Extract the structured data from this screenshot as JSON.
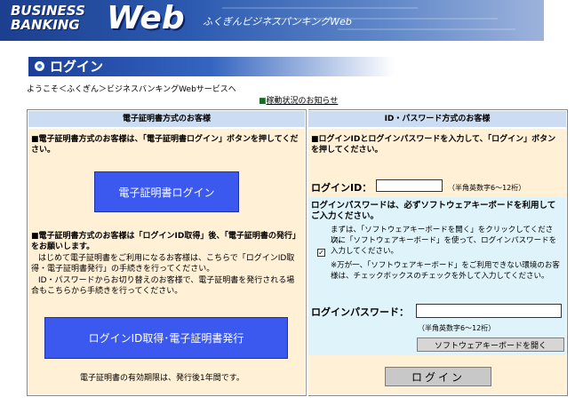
{
  "banner": {
    "logo_line1": "BUSINESS",
    "logo_line2": "BANKING",
    "logo_web": "Web",
    "subtitle": "ふくぎんビジネスバンキングWeb"
  },
  "page_title": "ログイン",
  "welcome": "ようこそ＜ふくぎん＞ビジネスバンキングWebサービスへ",
  "notice": {
    "bullet": "■",
    "link": "稼動状況のお知らせ"
  },
  "left": {
    "header": "電子証明書方式のお客様",
    "instr": "■電子証明書方式のお客様は、「電子証明書ログイン」ボタンを押してください。",
    "cert_login_button": "電子証明書ログイン",
    "issue_title": "■電子証明書方式のお客様は「ログインID取得」後、「電子証明書の発行」をお願いします。",
    "issue_p1": "はじめて電子証明書をご利用になるお客様は、こちらで「ログインID取得・電子証明書発行」の手続きを行ってください。",
    "issue_p2": "ID・パスワードからお切り替えのお客様で、電子証明書を発行される場合もこちらから手続きを行ってください。",
    "issue_button": "ログインID取得･電子証明書発行",
    "validity": "電子証明書の有効期限は、発行後1年間です。"
  },
  "right": {
    "header": "ID・パスワード方式のお客様",
    "instr": "■ログインIDとログインパスワードを入力して、「ログイン」ボタンを押してください。",
    "login_id_label": "ログインID：",
    "login_id_value": "",
    "login_id_hint": "（半角英数字6～12桁）",
    "kb_title": "ログインパスワードは、必ずソフトウェアキーボードを利用してご入力ください。",
    "kb_p1": "まずは、「ソフトウェアキーボードを開く」をクリックしてください。",
    "kb_p2": "次に「ソフトウェアキーボード」を使って、ログインパスワードを入力してください。",
    "kb_p3": "※万が一、「ソフトウェアキーボード」をご利用できない環境のお客様は、チェックボックスのチェックを外して入力してください。",
    "checkbox_checked": true,
    "checkbox_glyph": "✓",
    "password_label": "ログインパスワード：",
    "password_value": "",
    "password_hint": "（半角英数字6～12桁）",
    "open_kb_button": "ソフトウェアキーボードを開く",
    "login_button": "ログイン"
  }
}
